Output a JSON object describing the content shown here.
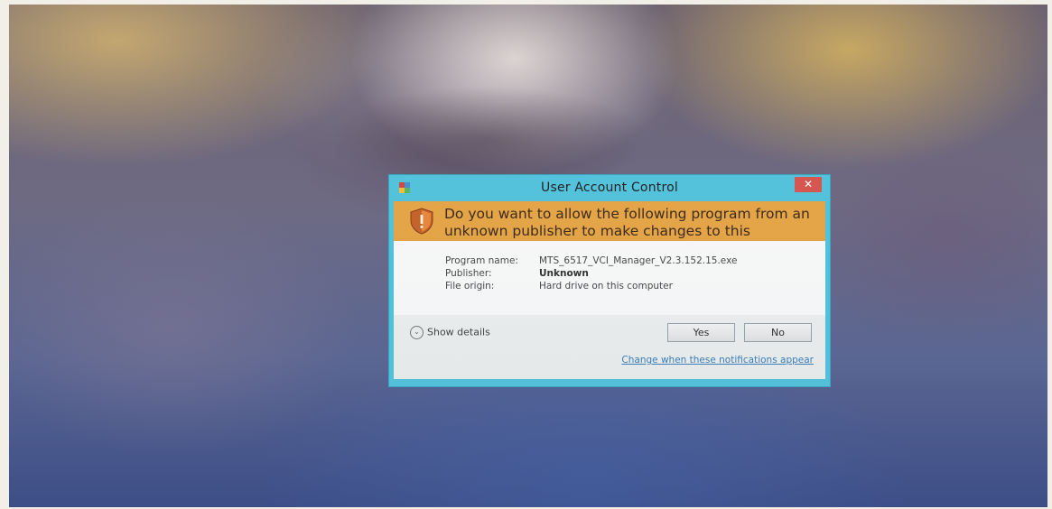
{
  "dialog": {
    "title": "User Account Control",
    "close_label": "✕",
    "prompt": "Do you want to allow the following program from an unknown publisher to make changes to this computer?",
    "fields": [
      {
        "label": "Program name:",
        "value": "MTS_6517_VCI_Manager_V2.3.152.15.exe"
      },
      {
        "label": "Publisher:",
        "value": "Unknown"
      },
      {
        "label": "File origin:",
        "value": "Hard drive on this computer"
      }
    ],
    "show_details_label": "Show details",
    "yes_label": "Yes",
    "no_label": "No",
    "notifications_link": "Change when these notifications appear"
  },
  "colors": {
    "title_bar": "#54c4dc",
    "banner": "#e8a646",
    "close_button": "#d9574f"
  },
  "icons": {
    "title": "uac-shield-icon",
    "banner": "warning-shield-icon",
    "details": "chevron-down-icon"
  }
}
